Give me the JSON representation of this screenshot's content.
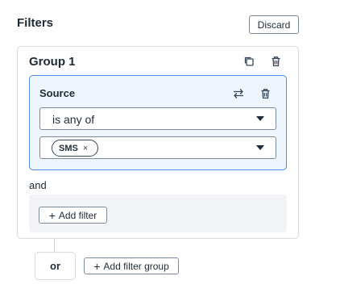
{
  "header": {
    "title": "Filters",
    "discard_label": "Discard"
  },
  "group": {
    "title": "Group 1",
    "icons": [
      "copy-icon",
      "trash-icon"
    ],
    "filter": {
      "property": "Source",
      "icons": [
        "swap-icon",
        "trash-icon"
      ],
      "operator": "is any of",
      "values": [
        {
          "label": "SMS",
          "remove": "×"
        }
      ]
    },
    "and_label": "and",
    "add_filter_label": "Add filter"
  },
  "footer": {
    "or_label": "or",
    "add_group_label": "Add filter group"
  },
  "colors": {
    "accent": "#4d8fd8",
    "card_bg": "#eef5fc",
    "area_bg": "#f1f3f6"
  }
}
